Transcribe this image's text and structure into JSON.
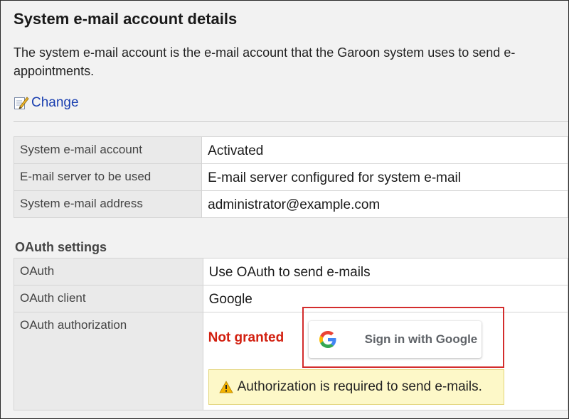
{
  "page": {
    "title": "System e-mail account details",
    "description_line1": "The system e-mail account is the e-mail account that the Garoon system uses to send e-",
    "description_line2": "appointments.",
    "change_link": "Change",
    "icon_change": "edit-note-icon"
  },
  "system_table": {
    "rows": [
      {
        "key": "System e-mail account",
        "value": "Activated"
      },
      {
        "key": "E-mail server to be used",
        "value": "E-mail server configured for system e-mail"
      },
      {
        "key": "System e-mail address",
        "value": "administrator@example.com"
      }
    ]
  },
  "oauth": {
    "heading": "OAuth settings",
    "rows": [
      {
        "key": "OAuth",
        "value": "Use OAuth to send e-mails"
      },
      {
        "key": "OAuth client",
        "value": "Google"
      },
      {
        "key": "OAuth authorization"
      }
    ],
    "status": "Not granted",
    "status_color": "#d21f0f",
    "sign_in_label": "Sign in with Google",
    "sign_in_icon": "google-g-icon",
    "warning_text": "Authorization is required to send e-mails.",
    "warning_icon": "warning-triangle-icon",
    "highlight_color": "#d32c2c"
  },
  "colors": {
    "link": "#1a3fb0",
    "background": "#f2f2f2",
    "key_cell": "#eaeaea",
    "warning_bg": "#fdf8c8"
  }
}
